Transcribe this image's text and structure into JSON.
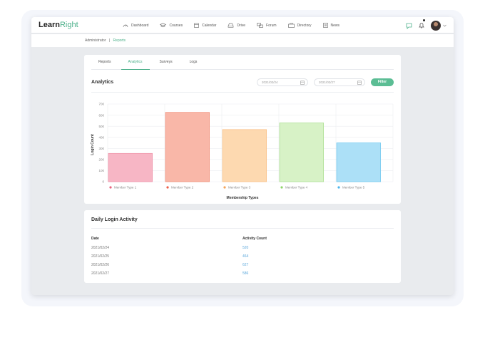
{
  "brand": {
    "name_dark": "Learn",
    "name_accent": "Right"
  },
  "nav": [
    {
      "label": "Dashboard",
      "icon": "dashboard-icon"
    },
    {
      "label": "Courses",
      "icon": "graduation-cap-icon"
    },
    {
      "label": "Calendar",
      "icon": "calendar-icon"
    },
    {
      "label": "Drive",
      "icon": "drive-icon"
    },
    {
      "label": "Forum",
      "icon": "forum-icon"
    },
    {
      "label": "Directory",
      "icon": "directory-icon"
    },
    {
      "label": "News",
      "icon": "news-icon"
    }
  ],
  "breadcrumb": {
    "root": "Administrator",
    "separator": "|",
    "current": "Reports"
  },
  "tabs": [
    "Reports",
    "Analytics",
    "Surveys",
    "Logs"
  ],
  "active_tab": "Analytics",
  "analytics": {
    "title": "Analytics",
    "date_from": "2021/02/24",
    "date_to": "2021/02/27",
    "filter_label": "Filter"
  },
  "chart_data": {
    "type": "bar",
    "categories": [
      "Member Type 1",
      "Member Type 2",
      "Member Type 3",
      "Member Type 4",
      "Member Type 5"
    ],
    "values": [
      255,
      625,
      470,
      530,
      350
    ],
    "colors": [
      "#f7b6c5",
      "#f9b7a8",
      "#fdd9b0",
      "#d7f2c6",
      "#ace0f7"
    ],
    "stroke_colors": [
      "#ee8fa6",
      "#f08c77",
      "#f8bf84",
      "#a9de8e",
      "#6cc6ee"
    ],
    "legend_dot_colors": [
      "#e8647f",
      "#ec5f4a",
      "#f5a55a",
      "#8fd46a",
      "#4cb5ec"
    ],
    "xlabel": "Membership Types",
    "ylabel": "Login Count",
    "ylim": [
      0,
      700
    ],
    "yticks": [
      0,
      100,
      200,
      300,
      400,
      500,
      600,
      700
    ],
    "grid": true,
    "legend": "bottom"
  },
  "daily": {
    "title": "Daily Login Activity",
    "columns": [
      "Date",
      "Activity Count"
    ],
    "rows": [
      {
        "date": "2021/02/24",
        "count": "520"
      },
      {
        "date": "2021/02/25",
        "count": "464"
      },
      {
        "date": "2021/02/26",
        "count": "627"
      },
      {
        "date": "2021/02/27",
        "count": "586"
      }
    ]
  },
  "colors": {
    "accent": "#4cb08a",
    "link": "#5aa7db"
  }
}
